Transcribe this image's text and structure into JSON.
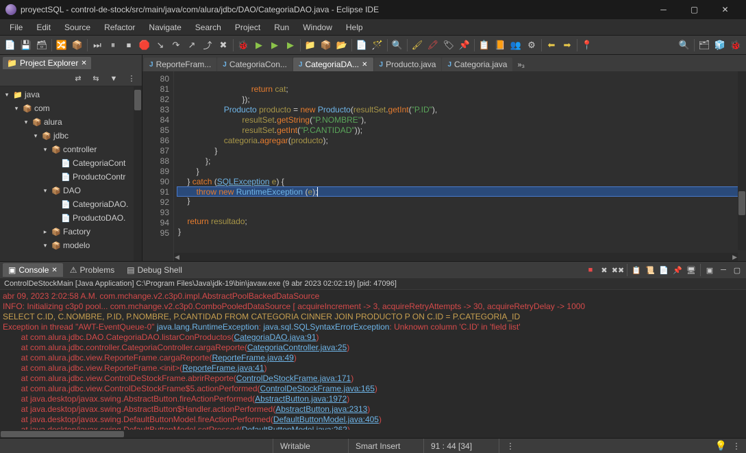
{
  "title": "proyectSQL - control-de-stock/src/main/java/com/alura/jdbc/DAO/CategoriaDAO.java - Eclipse IDE",
  "menu": [
    "File",
    "Edit",
    "Source",
    "Refactor",
    "Navigate",
    "Search",
    "Project",
    "Run",
    "Window",
    "Help"
  ],
  "explorer": {
    "title": "Project Explorer",
    "tree": [
      {
        "depth": 0,
        "toggle": "▾",
        "icon": "folder",
        "label": "java"
      },
      {
        "depth": 1,
        "toggle": "▾",
        "icon": "package",
        "label": "com"
      },
      {
        "depth": 2,
        "toggle": "▾",
        "icon": "package",
        "label": "alura"
      },
      {
        "depth": 3,
        "toggle": "▾",
        "icon": "package",
        "label": "jdbc"
      },
      {
        "depth": 4,
        "toggle": "▾",
        "icon": "package",
        "label": "controller"
      },
      {
        "depth": 5,
        "toggle": " ",
        "icon": "java",
        "label": "CategoriaCont"
      },
      {
        "depth": 5,
        "toggle": " ",
        "icon": "java",
        "label": "ProductoContr"
      },
      {
        "depth": 4,
        "toggle": "▾",
        "icon": "package",
        "label": "DAO"
      },
      {
        "depth": 5,
        "toggle": " ",
        "icon": "java",
        "label": "CategoriaDAO."
      },
      {
        "depth": 5,
        "toggle": " ",
        "icon": "java",
        "label": "ProductoDAO."
      },
      {
        "depth": 4,
        "toggle": "▸",
        "icon": "package",
        "label": "Factory"
      },
      {
        "depth": 4,
        "toggle": "▾",
        "icon": "package",
        "label": "modelo"
      }
    ]
  },
  "editor": {
    "tabs": [
      {
        "label": "ReporteFram...",
        "active": false
      },
      {
        "label": "CategoriaCon...",
        "active": false
      },
      {
        "label": "CategoriaDA...",
        "active": true
      },
      {
        "label": "Producto.java",
        "active": false
      },
      {
        "label": "Categoria.java",
        "active": false
      }
    ],
    "extraTabs": "»₃",
    "startLine": 80,
    "endLine": 95,
    "highlightLine": 91
  },
  "bottom": {
    "tabs": [
      {
        "label": "Console",
        "active": true,
        "icon": "▣"
      },
      {
        "label": "Problems",
        "active": false,
        "icon": "⚠"
      },
      {
        "label": "Debug Shell",
        "active": false,
        "icon": "▤"
      }
    ],
    "header": "ControlDeStockMain [Java Application] C:\\Program Files\\Java\\jdk-19\\bin\\javaw.exe (9 abr 2023 02:02:19) [pid: 47096]"
  },
  "status": {
    "writable": "Writable",
    "insert": "Smart Insert",
    "pos": "91 : 44 [34]"
  }
}
